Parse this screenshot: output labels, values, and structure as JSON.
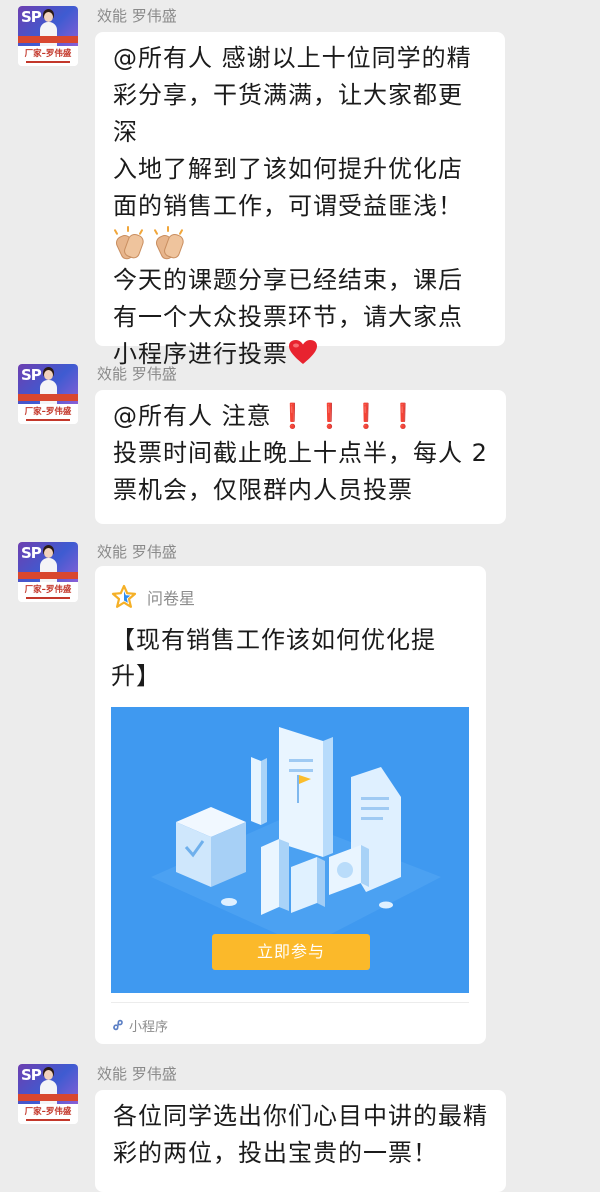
{
  "avatar": {
    "badge_letter": "SP",
    "footer_text": "厂家–罗伟盛"
  },
  "messages": [
    {
      "sender": "效能 罗伟盛",
      "lines_1": [
        "@所有人 感谢以上十位同学的精",
        "彩分享，干货满满，让大家都更深",
        "入地了解到了该如何提升优化店",
        "面的销售工作，可谓受益匪浅！"
      ],
      "emoji_1": [
        "clapping-hands",
        "clapping-hands"
      ],
      "lines_2": [
        "今天的课题分享已经结束，课后",
        "有一个大众投票环节，请大家点"
      ],
      "last_line": "小程序进行投票",
      "trailing_emoji": "red-heart"
    },
    {
      "sender": "效能 罗伟盛",
      "line_1": "@所有人  注意",
      "exclamations": [
        "❗",
        "❗",
        "❗",
        "❗"
      ],
      "lines": [
        "投票时间截止晚上十点半，每人 2",
        "票机会，仅限群内人员投票"
      ]
    },
    {
      "sender": "效能 罗伟盛",
      "card": {
        "source_name": "问卷星",
        "source_icon": "star-icon",
        "title_lines": [
          "【现有销售工作该如何优化提",
          "升】"
        ],
        "button_label": "立即参与",
        "footer_label": "小程序",
        "footer_icon": "mini-program-icon",
        "cover_color": "#3f99f0",
        "button_color": "#fbb92a"
      }
    },
    {
      "sender": "效能 罗伟盛",
      "lines": [
        "各位同学选出你们心目中讲的最精",
        "彩的两位，投出宝贵的一票！"
      ]
    }
  ]
}
